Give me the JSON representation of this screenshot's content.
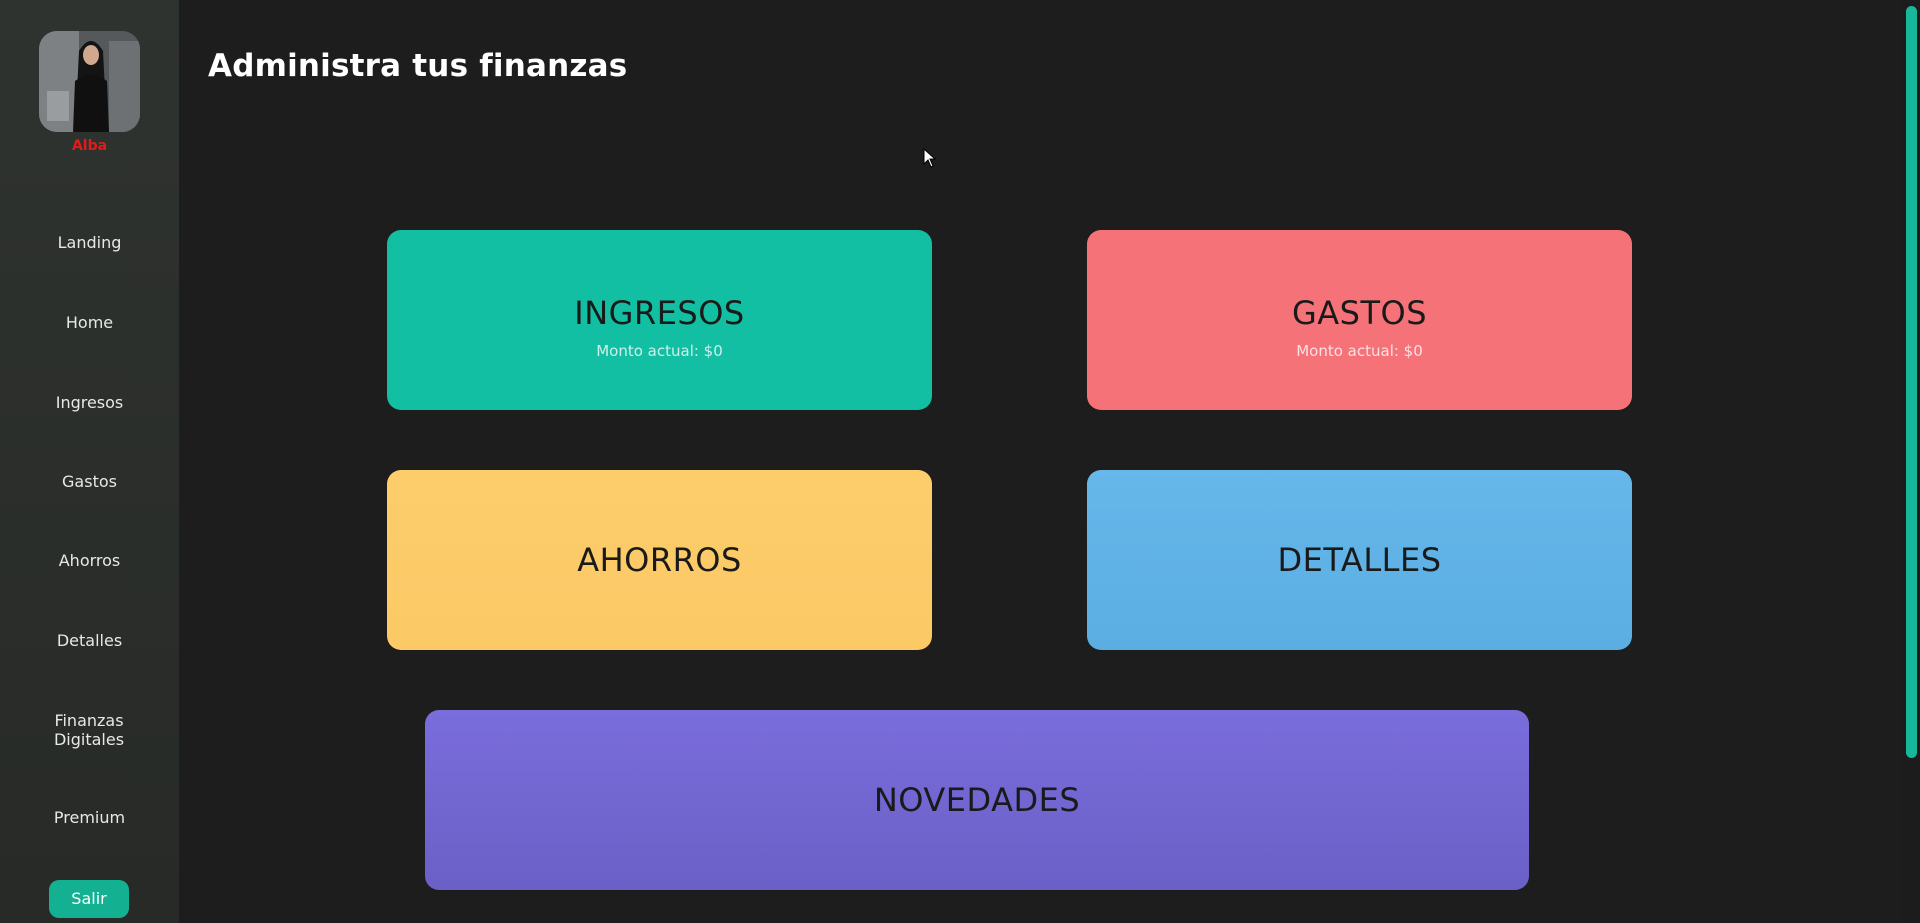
{
  "sidebar": {
    "username": "Alba",
    "items": [
      {
        "label": "Landing"
      },
      {
        "label": "Home"
      },
      {
        "label": "Ingresos"
      },
      {
        "label": "Gastos"
      },
      {
        "label": "Ahorros"
      },
      {
        "label": "Detalles"
      },
      {
        "label": "Finanzas Digitales"
      },
      {
        "label": "Premium"
      }
    ],
    "logout_label": "Salir"
  },
  "header": {
    "title": "Administra tus finanzas"
  },
  "cards": {
    "ingresos": {
      "title": "INGRESOS",
      "subtitle": "Monto actual: $0"
    },
    "gastos": {
      "title": "GASTOS",
      "subtitle": "Monto actual: $0"
    },
    "ahorros": {
      "title": "AHORROS"
    },
    "detalles": {
      "title": "DETALLES"
    },
    "novedades": {
      "title": "NOVEDADES"
    }
  },
  "colors": {
    "accent": "#13b191",
    "ingresos": "#12bfa2",
    "gastos": "#f57378",
    "ahorros": "#fdcd6c",
    "detalles": "#66b7ea",
    "novedades": "#7a6ddc",
    "username": "#e11b1b"
  }
}
